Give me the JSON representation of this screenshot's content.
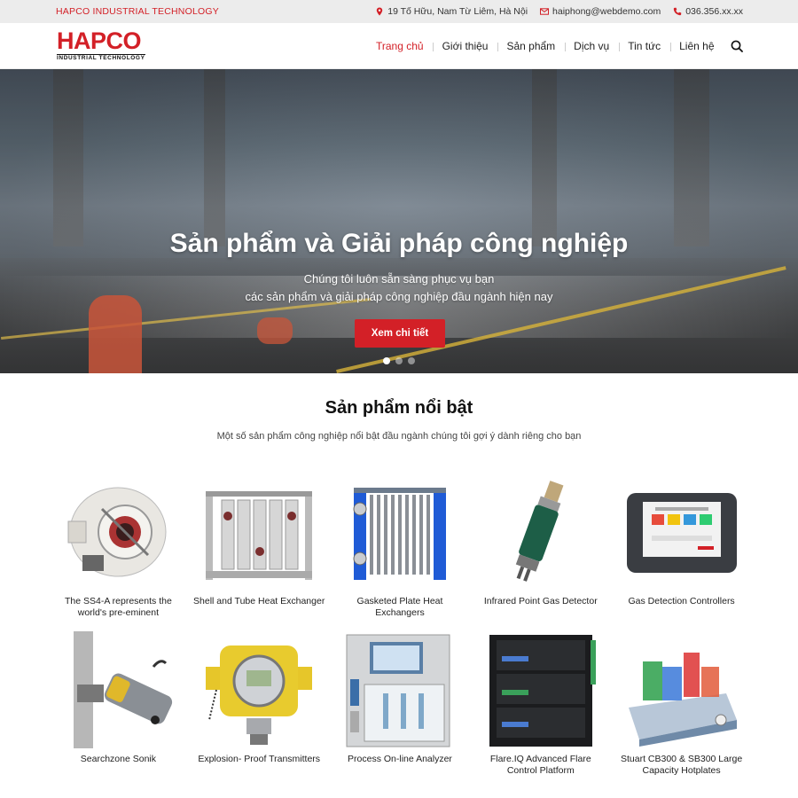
{
  "topbar": {
    "brand": "HAPCO INDUSTRIAL TECHNOLOGY",
    "address": "19 Tố Hữu, Nam Từ Liêm, Hà Nội",
    "email": "haiphong@webdemo.com",
    "phone": "036.356.xx.xx"
  },
  "logo": {
    "word": "HAPCO",
    "sub": "INDUSTRIAL TECHNOLOGY"
  },
  "nav": {
    "items": [
      "Trang chủ",
      "Giới thiệu",
      "Sản phẩm",
      "Dịch vụ",
      "Tin tức",
      "Liên hệ"
    ],
    "active_index": 0
  },
  "hero": {
    "title": "Sản phẩm và Giải pháp công nghiệp",
    "subtitle_line1": "Chúng tôi luôn sẵn sàng phục vụ bạn",
    "subtitle_line2": "các sản phẩm và giải pháp công nghiệp đầu ngành hiện nay",
    "cta": "Xem chi tiết",
    "slides": 3,
    "active_slide": 1
  },
  "products": {
    "title": "Sản phẩm nổi bật",
    "subtitle": "Một số sản phẩm công nghiệp nổi bật đầu ngành chúng tôi gợi ý dành riêng cho bạn",
    "items": [
      {
        "name": "The SS4-A represents the world's pre-eminent",
        "icon": "flame-detector-icon"
      },
      {
        "name": "Shell and Tube Heat Exchanger",
        "icon": "heat-exchanger-frame-icon"
      },
      {
        "name": "Gasketed Plate Heat Exchangers",
        "icon": "plate-heat-exchanger-icon"
      },
      {
        "name": "Infrared Point Gas Detector",
        "icon": "gas-detector-icon"
      },
      {
        "name": "Gas Detection Controllers",
        "icon": "controller-panel-icon"
      },
      {
        "name": "Searchzone Sonik",
        "icon": "sonic-detector-icon"
      },
      {
        "name": "Explosion- Proof Transmitters",
        "icon": "transmitter-icon"
      },
      {
        "name": "Process On-line Analyzer",
        "icon": "analyzer-cabinet-icon"
      },
      {
        "name": "Flare.IQ Advanced Flare Control Platform",
        "icon": "server-rack-icon"
      },
      {
        "name": "Stuart CB300 & SB300 Large Capacity Hotplates",
        "icon": "hotplate-icon"
      }
    ]
  },
  "colors": {
    "accent": "#d32027",
    "topbar_bg": "#ececec"
  }
}
